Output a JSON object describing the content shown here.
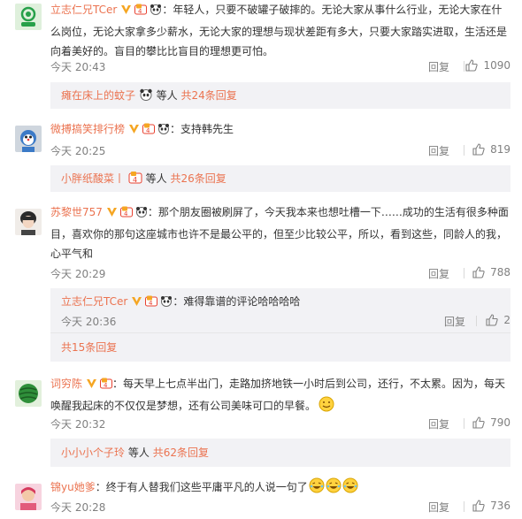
{
  "comments": [
    {
      "user": "立志仁兄TCer",
      "text_line1": "：年轻人，只要不破罐子破摔的。无论大家从事什么行业，无论大家在什",
      "text_line2": "么岗位，无论大家拿多少薪水，无论大家的理想与现状差距有多大，只要大家踏实进取，生活还是",
      "text_line3": "向着美好的。盲目的攀比比盲目的理想更可怕。",
      "time": "今天 20:43",
      "reply_label": "回复",
      "likes": "1090",
      "sub_user": "瘫在床上的蚊子",
      "sub_etc": "等人",
      "sub_count": "共24条回复"
    },
    {
      "user": "微搏搞笑排行榜",
      "text_line1": "：支持韩先生",
      "time": "今天 20:25",
      "reply_label": "回复",
      "likes": "819",
      "sub_user": "小胖纸酸菜丨",
      "sub_etc": "等人",
      "sub_count": "共26条回复"
    },
    {
      "user": "苏黎世757",
      "text_line1": "：那个朋友圈被刷屏了，今天我本来也想吐槽一下……成功的生活有很多种面",
      "text_line2": "目，喜欢你的那句这座城市也许不是最公平的，但至少比较公平，所以，看到这些，同龄人的我，",
      "text_line3": "心平气和",
      "time": "今天 20:29",
      "reply_label": "回复",
      "likes": "788",
      "reply": {
        "user": "立志仁兄TCer",
        "text": "：难得靠谱的评论哈哈哈哈",
        "time": "今天 20:36",
        "reply_label": "回复",
        "likes": "2",
        "count": "共15条回复"
      }
    },
    {
      "user": "词穷陈",
      "text_line1": "：每天早上七点半出门，走路加挤地铁一小时后到公司，还行，不太累。因为，每天",
      "text_line2": "唤醒我起床的不仅仅是梦想，还有公司美味可口的早餐。",
      "time": "今天 20:32",
      "reply_label": "回复",
      "likes": "790",
      "sub_user": "小小小个子玲",
      "sub_etc": "等人",
      "sub_count": "共62条回复"
    },
    {
      "user": "锦yu她爹",
      "text_line1": "：终于有人替我们这些平庸平凡的人说一句了",
      "time": "今天 20:28",
      "reply_label": "回复",
      "likes": "736"
    }
  ],
  "colors": {
    "link": "#eb7350",
    "meta": "#808080",
    "sub_bg": "#f2f2f5",
    "vip_gold": "#f5a623"
  }
}
